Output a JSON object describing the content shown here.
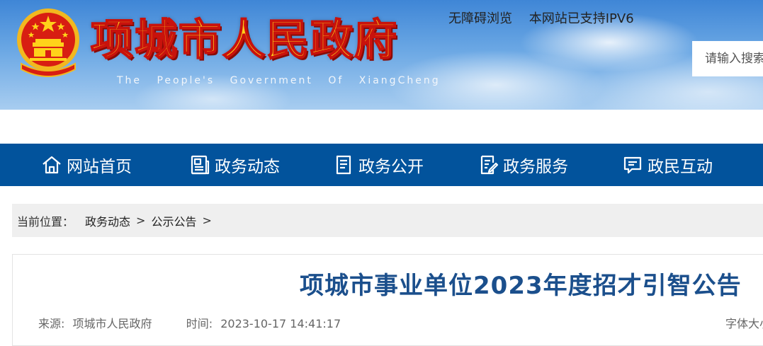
{
  "header": {
    "site_title": "项城市人民政府",
    "site_subtitle": "The People's Government Of XiangCheng",
    "top_links": [
      "无障碍浏览",
      "本网站已支持IPV6"
    ],
    "search_placeholder": "请输入搜索"
  },
  "nav": {
    "items": [
      {
        "label": "网站首页",
        "icon": "home-icon"
      },
      {
        "label": "政务动态",
        "icon": "newspaper-icon"
      },
      {
        "label": "政务公开",
        "icon": "document-icon"
      },
      {
        "label": "政务服务",
        "icon": "edit-document-icon"
      },
      {
        "label": "政民互动",
        "icon": "chat-icon"
      }
    ]
  },
  "breadcrumb": {
    "label": "当前位置：",
    "items": [
      "政务动态",
      "公示公告"
    ],
    "separator": ">"
  },
  "article": {
    "title": "项城市事业单位2023年度招才引智公告",
    "source_label": "来源:",
    "source": "项城市人民政府",
    "time_label": "时间:",
    "time": "2023-10-17 14:41:17",
    "font_size_label": "字体大小"
  },
  "colors": {
    "nav_bg": "#02539c",
    "title_color": "#1b4f8c",
    "banner_title": "#ffd11a",
    "banner_title_stroke": "#c8120c"
  }
}
